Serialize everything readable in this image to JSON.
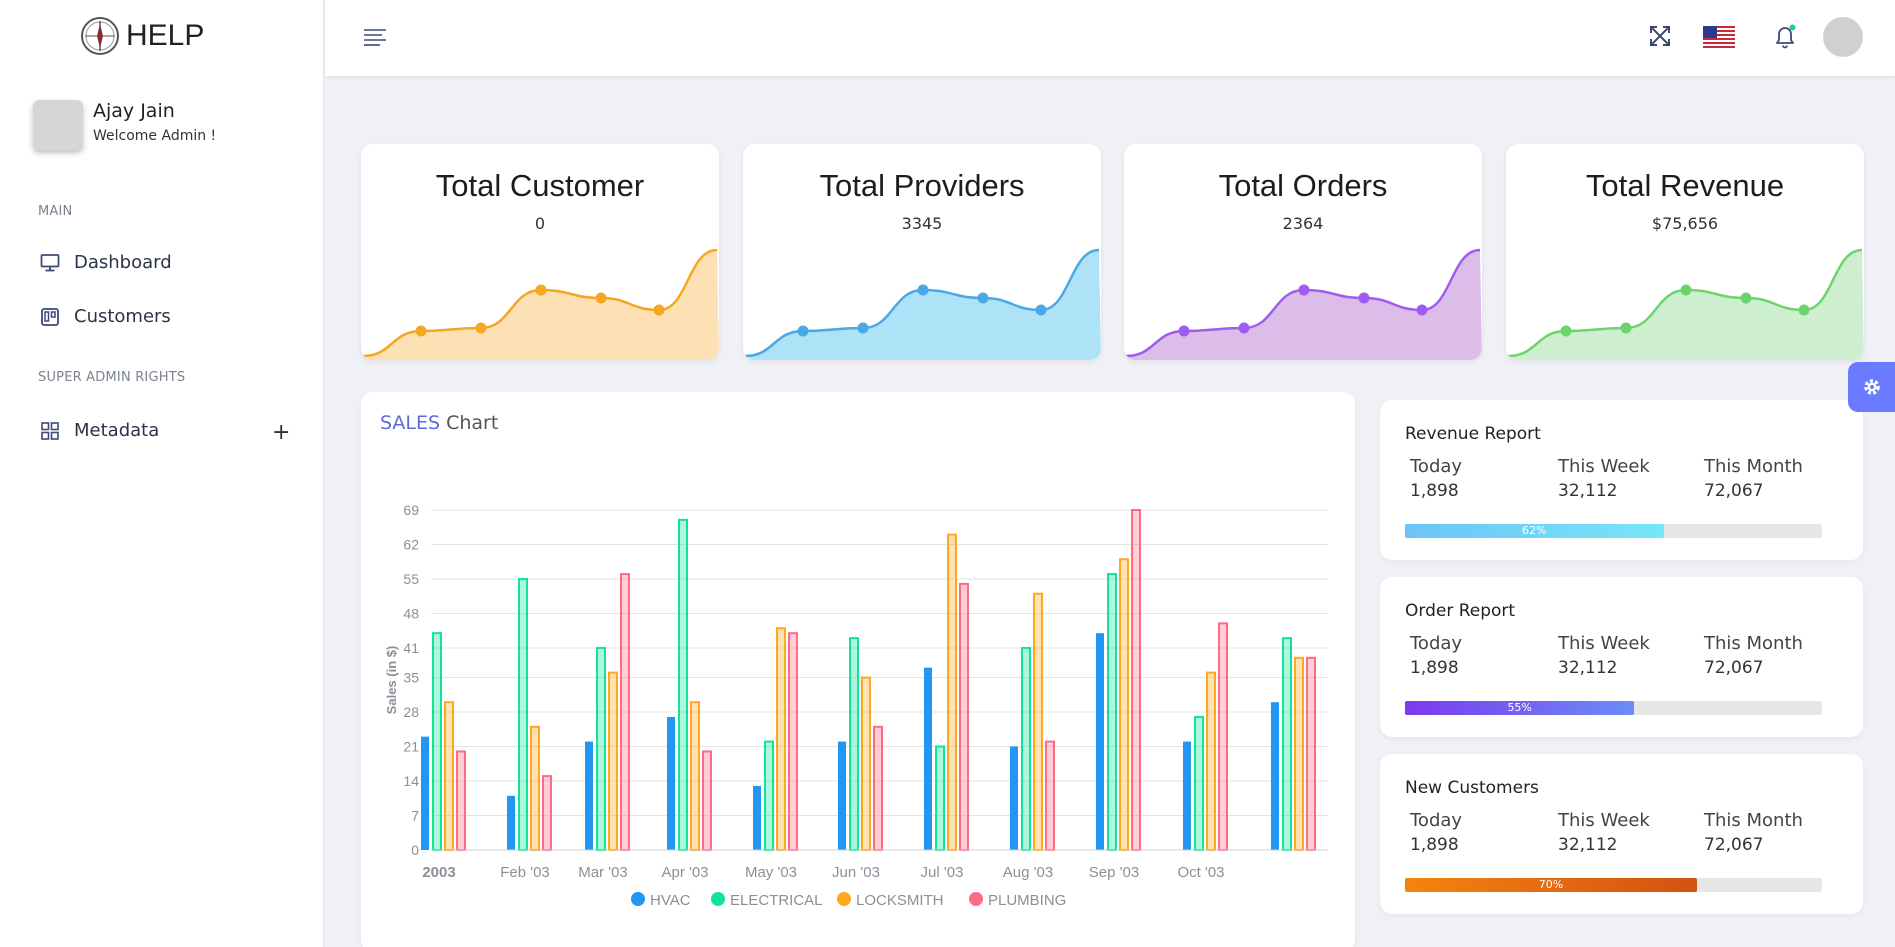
{
  "app": {
    "brand": "HELP"
  },
  "profile": {
    "name": "Ajay Jain",
    "welcome": "Welcome Admin !"
  },
  "sidebar": {
    "section_main": "MAIN",
    "items": [
      {
        "label": "Dashboard",
        "icon": "monitor-icon"
      },
      {
        "label": "Customers",
        "icon": "trello-icon"
      }
    ],
    "section_admin": "SUPER ADMIN RIGHTS",
    "metadata": {
      "label": "Metadata",
      "icon": "grid-icon",
      "expand": "+"
    }
  },
  "topbar": {
    "icons": [
      "menu-icon",
      "fullscreen-icon",
      "us-flag-icon",
      "bell-icon",
      "user-avatar"
    ]
  },
  "stats": [
    {
      "title": "Total Customer",
      "value": "0",
      "color": "#f5a623",
      "fill": "#fde0b4"
    },
    {
      "title": "Total Providers",
      "value": "3345",
      "color": "#4aa8e6",
      "fill": "#aee2f7"
    },
    {
      "title": "Total Orders",
      "value": "2364",
      "color": "#a05cf0",
      "fill": "#dcbde9"
    },
    {
      "title": "Total Revenue",
      "value": "$75,656",
      "color": "#6dd46d",
      "fill": "#cdefd0"
    }
  ],
  "sales_chart": {
    "title_a": "SALES",
    "title_b": "Chart"
  },
  "chart_data": {
    "type": "bar",
    "title": "SALES Chart",
    "xlabel": "",
    "ylabel": "Sales (in $)",
    "ylim": [
      0,
      69
    ],
    "yticks": [
      0,
      7,
      14,
      21,
      28,
      35,
      41,
      48,
      55,
      62,
      69
    ],
    "categories": [
      "2003",
      "Feb '03",
      "Mar '03",
      "Apr '03",
      "May '03",
      "Jun '03",
      "Jul '03",
      "Aug '03",
      "Sep '03",
      "Oct '03",
      ""
    ],
    "series": [
      {
        "name": "HVAC",
        "color": "#2196f3",
        "values": [
          23,
          11,
          22,
          27,
          13,
          22,
          37,
          21,
          44,
          22,
          30
        ]
      },
      {
        "name": "ELECTRICAL",
        "color": "#10e39a",
        "values": [
          44,
          55,
          41,
          67,
          22,
          43,
          21,
          41,
          56,
          27,
          43
        ]
      },
      {
        "name": "LOCKSMITH",
        "color": "#ffa81f",
        "values": [
          30,
          25,
          36,
          30,
          45,
          35,
          64,
          52,
          59,
          36,
          39
        ]
      },
      {
        "name": "PLUMBING",
        "color": "#ff6b87",
        "values": [
          20,
          15,
          56,
          20,
          44,
          25,
          54,
          22,
          69,
          46,
          39
        ]
      }
    ],
    "legend": "bottom"
  },
  "reports": [
    {
      "title": "Revenue Report",
      "today_label": "Today",
      "week_label": "This Week",
      "month_label": "This Month",
      "today": "1,898",
      "week": "32,112",
      "month": "72,067",
      "progress_label": "62%",
      "progress": 0.62,
      "from": "#6cc4f6",
      "to": "#77e6f8"
    },
    {
      "title": "Order Report",
      "today_label": "Today",
      "week_label": "This Week",
      "month_label": "This Month",
      "today": "1,898",
      "week": "32,112",
      "month": "72,067",
      "progress_label": "55%",
      "progress": 0.55,
      "from": "#7c3aed",
      "to": "#6b8cf7"
    },
    {
      "title": "New Customers",
      "today_label": "Today",
      "week_label": "This Week",
      "month_label": "This Month",
      "today": "1,898",
      "week": "32,112",
      "month": "72,067",
      "progress_label": "70%",
      "progress": 0.7,
      "from": "#f7830f",
      "to": "#d35112"
    }
  ]
}
